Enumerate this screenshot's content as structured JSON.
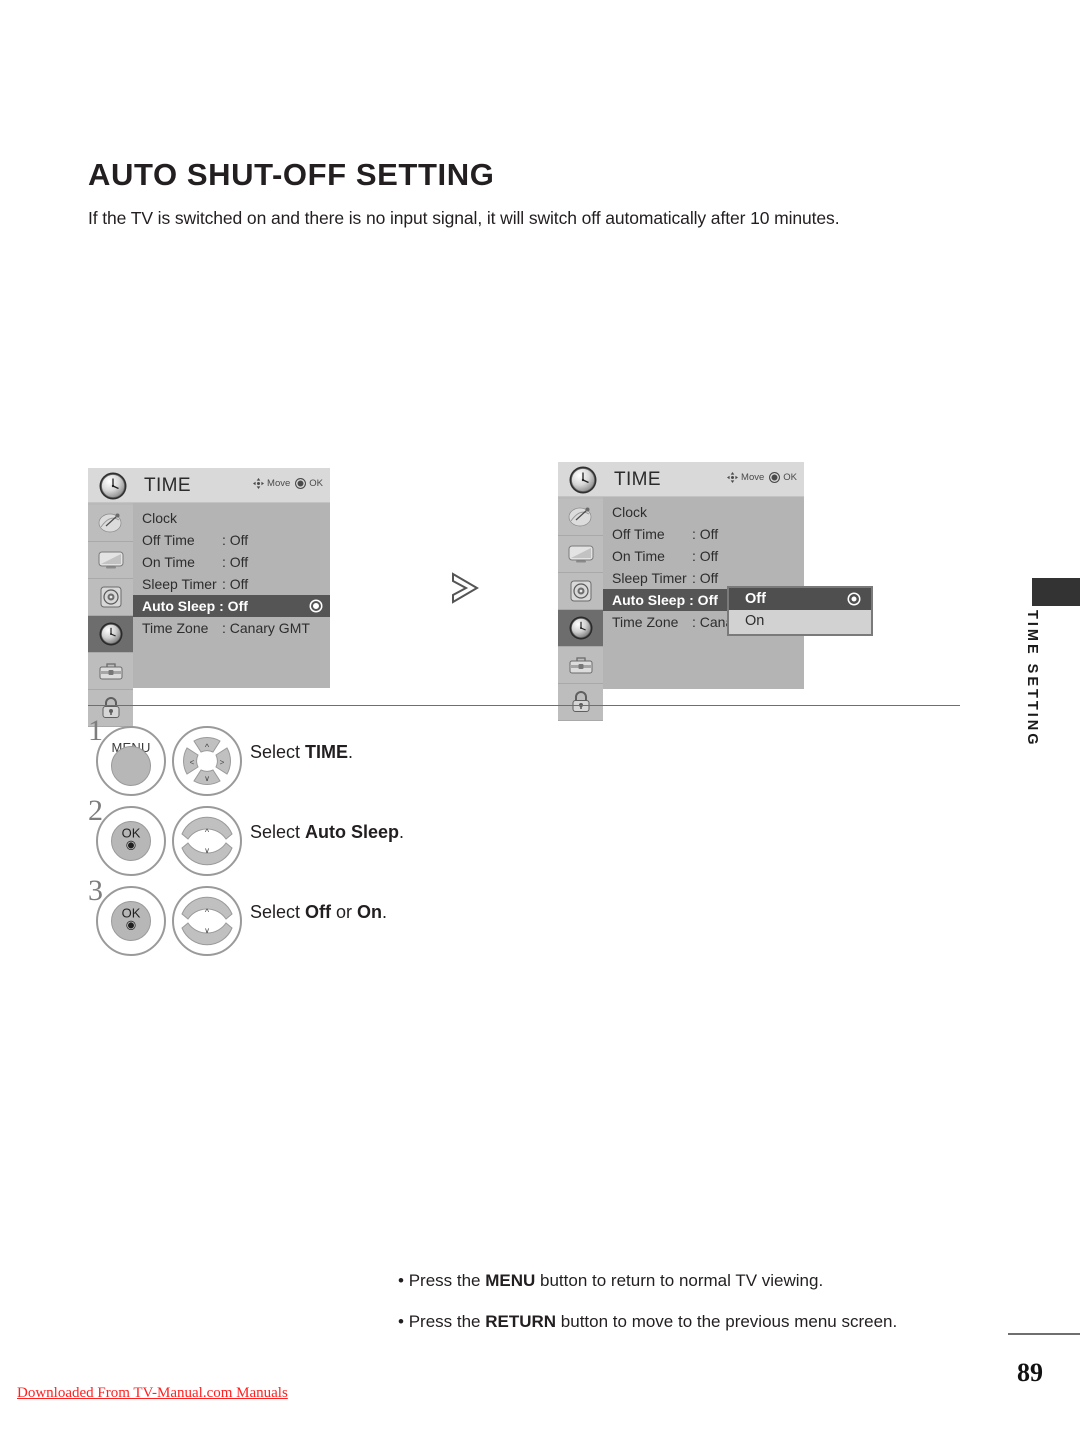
{
  "page": {
    "title": "AUTO SHUT-OFF SETTING",
    "intro": "If the TV is switched on and there is no input signal, it will switch off automatically after 10 minutes.",
    "number": "89",
    "side_tab": "TIME SETTING",
    "watermark": "Downloaded From TV-Manual.com Manuals"
  },
  "osd": {
    "title": "TIME",
    "hint_move": "Move",
    "hint_ok": "OK",
    "icons": [
      "satellite-dish-icon",
      "tv-picture-icon",
      "audio-speaker-icon",
      "clock-icon",
      "toolbox-icon",
      "lock-icon"
    ],
    "active_icon_index": 3,
    "rows": [
      {
        "name": "Clock",
        "value": ""
      },
      {
        "name": "Off Time",
        "value": ": Off"
      },
      {
        "name": "On Time",
        "value": ": Off"
      },
      {
        "name": "Sleep Timer",
        "value": ": Off"
      },
      {
        "name": "Auto Sleep",
        "value": ": Off"
      },
      {
        "name": "Time Zone",
        "value": ": Canary GMT"
      }
    ],
    "rows_panel2": [
      {
        "name": "Clock",
        "value": ""
      },
      {
        "name": "Off Time",
        "value": ": Off"
      },
      {
        "name": "On Time",
        "value": ": Off"
      },
      {
        "name": "Sleep Timer",
        "value": ": Off"
      },
      {
        "name": "Auto Sleep",
        "value": ": Off"
      },
      {
        "name": "Time Zone",
        "value": ": Canary"
      }
    ],
    "selected_row_index": 4,
    "dropdown": {
      "options": [
        "Off",
        "On"
      ],
      "selected": "Off"
    }
  },
  "steps": [
    {
      "num": "1",
      "left_button": "MENU",
      "right_button": "dpad-4way",
      "text_prefix": "Select ",
      "text_bold": "TIME",
      "text_suffix": "."
    },
    {
      "num": "2",
      "left_button": "OK",
      "right_button": "updown-rocker",
      "text_prefix": "Select ",
      "text_bold": "Auto Sleep",
      "text_suffix": "."
    },
    {
      "num": "3",
      "left_button": "OK",
      "right_button": "updown-rocker",
      "text_prefix": "Select ",
      "text_bold_a": "Off",
      "text_mid": " or ",
      "text_bold_b": "On",
      "text_suffix": "."
    }
  ],
  "notes": [
    {
      "bullet": "• ",
      "pre": "Press the ",
      "bold": "MENU",
      "post": " button to return to normal TV viewing."
    },
    {
      "bullet": "• ",
      "pre": "Press the ",
      "bold": "RETURN",
      "post": " button to move to the previous menu screen."
    }
  ],
  "colors": {
    "osd_bg": "#b4b4b4",
    "osd_header": "#d9d9d9",
    "osd_selected": "#555555",
    "dropdown_bg": "#d2d2d2",
    "side_tab": "#333333",
    "watermark": "#ff2020"
  }
}
